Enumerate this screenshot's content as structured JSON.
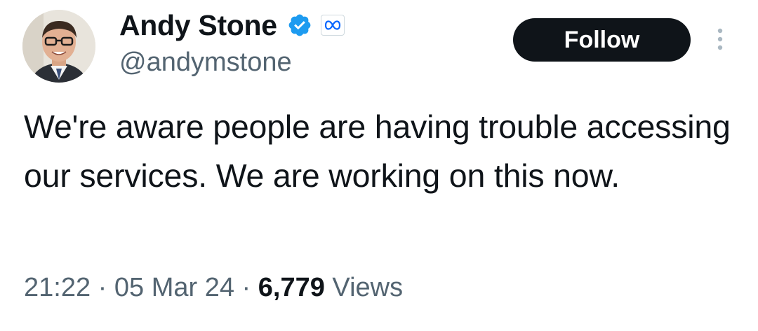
{
  "author": {
    "display_name": "Andy Stone",
    "handle": "@andymstone",
    "verified_icon": "verified-badge-icon",
    "affiliate_icon": "meta-logo-icon"
  },
  "actions": {
    "follow_label": "Follow",
    "more_icon": "more-vertical-icon"
  },
  "tweet": {
    "text": "We're aware people are having trouble accessing our services. We are working on this now."
  },
  "meta": {
    "time": "21:22",
    "separator": "·",
    "date": "05 Mar 24",
    "views_count": "6,779",
    "views_label": "Views"
  },
  "colors": {
    "text_primary": "#0f1419",
    "text_secondary": "#536471",
    "verified_blue": "#1d9bf0",
    "button_bg": "#0f1419",
    "button_text": "#ffffff"
  }
}
